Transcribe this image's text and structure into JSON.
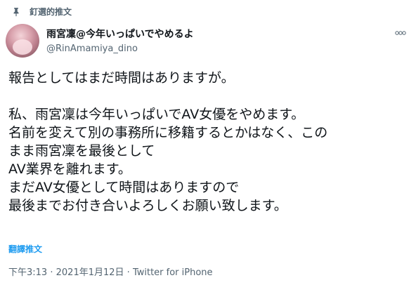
{
  "pinned": {
    "label": "釘選的推文"
  },
  "author": {
    "display_name": "雨宮凜@今年いっぱいでやめるよ",
    "handle": "@RinAmamiya_dino"
  },
  "more_label": "⊙⊙",
  "body_lines": [
    "報告としてはまだ時間はありますが。",
    "",
    "私、雨宮凜は今年いっぱいでAV女優をやめます。",
    "名前を変えて別の事務所に移籍するとかはなく、この",
    "まま雨宮凜を最後として",
    "AV業界を離れます。",
    "まだAV女優として時間はありますので",
    "最後までお付き合いよろしくお願い致します。"
  ],
  "translate_label": "翻譯推文",
  "meta": {
    "time": "下午3:13",
    "separator": "·",
    "date": "2021年1月12日",
    "source": "Twitter for iPhone"
  },
  "icons": {
    "pin": "pin-icon",
    "more": "more-options-icon"
  },
  "colors": {
    "accent": "#1d9bf0",
    "secondary_text": "#536471",
    "text": "#0f1419"
  }
}
